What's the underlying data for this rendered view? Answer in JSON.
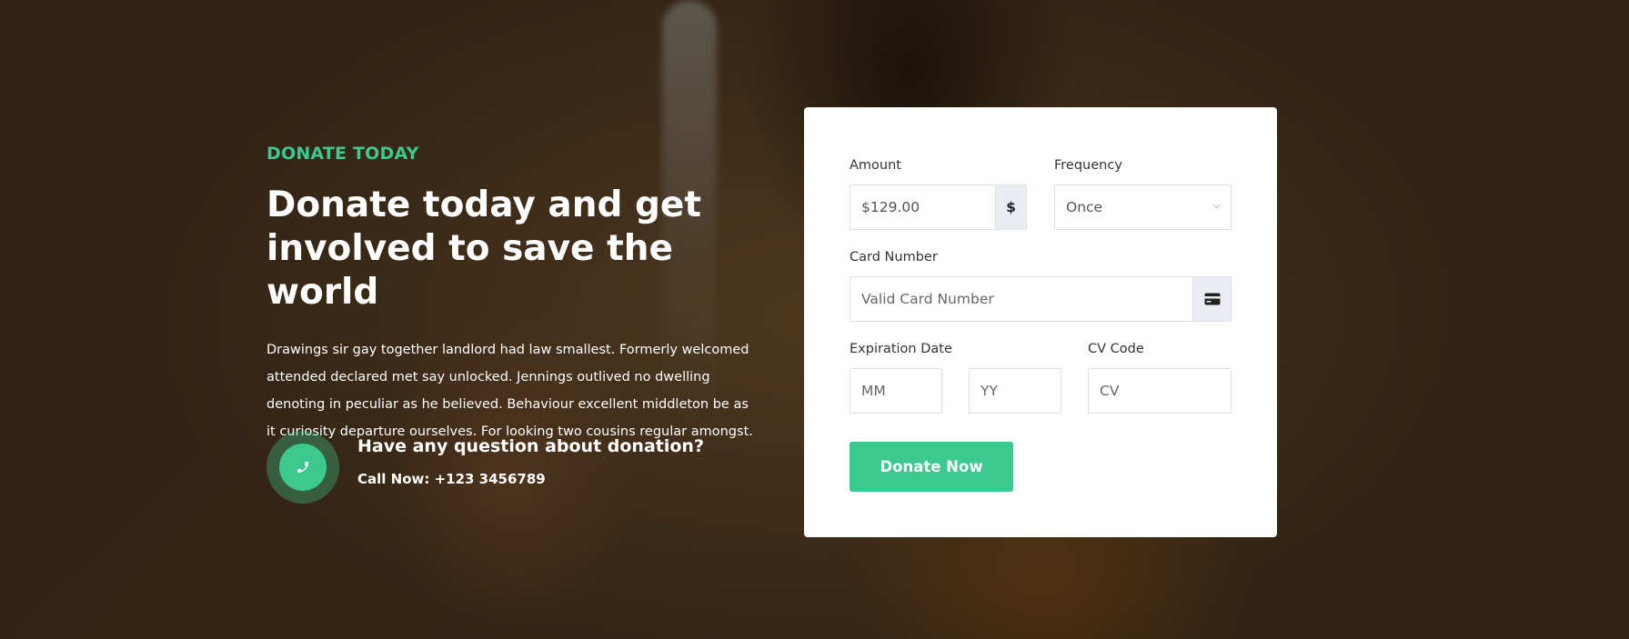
{
  "hero": {
    "kicker": "DONATE TODAY",
    "headline": "Donate today and get involved to save the world",
    "description": "Drawings sir gay together landlord had law smallest. Formerly welcomed attended declared met say unlocked. Jennings outlived no dwelling denoting in peculiar as he believed. Behaviour excellent middleton be as it curiosity departure ourselves. For looking two cousins regular amongst.",
    "contact_question": "Have any question about donation?",
    "contact_call": "Call Now: +123 3456789",
    "phone_icon": "phone-icon"
  },
  "form": {
    "amount_label": "Amount",
    "amount_value": "$129.00",
    "amount_addon": "$",
    "frequency_label": "Frequency",
    "frequency_value": "Once",
    "card_label": "Card Number",
    "card_placeholder": "Valid Card Number",
    "card_icon": "credit-card-icon",
    "expiration_label": "Expiration Date",
    "month_placeholder": "MM",
    "year_placeholder": "YY",
    "cvc_label": "CV Code",
    "cvc_placeholder": "CV",
    "submit_label": "Donate Now"
  },
  "colors": {
    "accent": "#3cc88e",
    "card_bg": "#ffffff",
    "addon_bg": "#e9edf3"
  }
}
